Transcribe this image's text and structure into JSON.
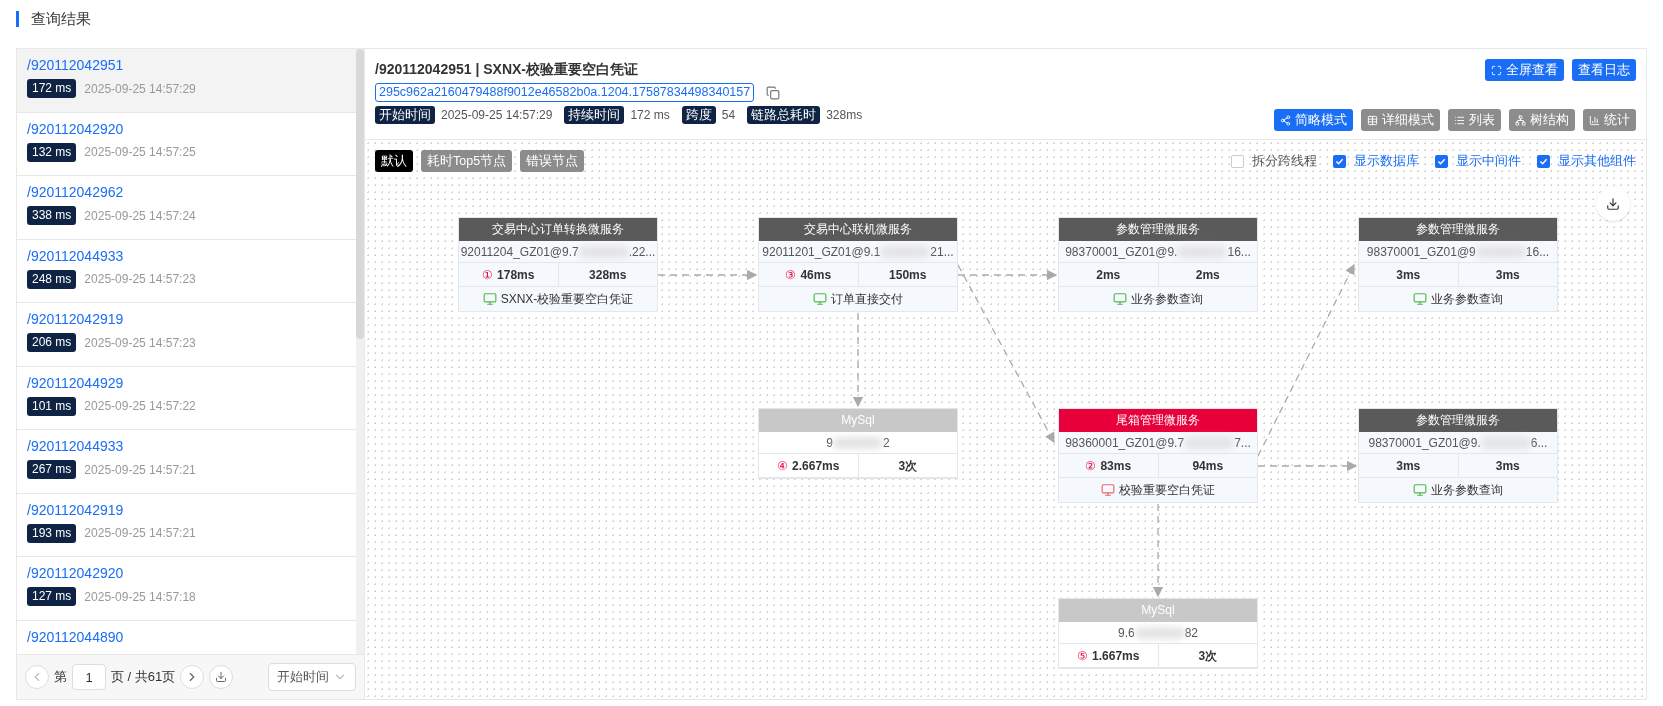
{
  "page_title": "查询结果",
  "results": [
    {
      "path": "/920112042951",
      "duration": "172 ms",
      "time": "2025-09-25 14:57:29",
      "selected": true
    },
    {
      "path": "/920112042920",
      "duration": "132 ms",
      "time": "2025-09-25 14:57:25",
      "selected": false
    },
    {
      "path": "/920112042962",
      "duration": "338 ms",
      "time": "2025-09-25 14:57:24",
      "selected": false
    },
    {
      "path": "/920112044933",
      "duration": "248 ms",
      "time": "2025-09-25 14:57:23",
      "selected": false
    },
    {
      "path": "/920112042919",
      "duration": "206 ms",
      "time": "2025-09-25 14:57:23",
      "selected": false
    },
    {
      "path": "/920112044929",
      "duration": "101 ms",
      "time": "2025-09-25 14:57:22",
      "selected": false
    },
    {
      "path": "/920112044933",
      "duration": "267 ms",
      "time": "2025-09-25 14:57:21",
      "selected": false
    },
    {
      "path": "/920112042919",
      "duration": "193 ms",
      "time": "2025-09-25 14:57:21",
      "selected": false
    },
    {
      "path": "/920112042920",
      "duration": "127 ms",
      "time": "2025-09-25 14:57:18",
      "selected": false
    },
    {
      "path": "/920112044890",
      "selected": false
    }
  ],
  "pagination": {
    "prefix": "第",
    "page": "1",
    "suffix": "页 / 共61页",
    "sort": "开始时间"
  },
  "detail": {
    "title": "/920112042951 | SXNX-校验重要空白凭证",
    "trace_id": "295c962a2160479488f9012e46582b0a.1204.17587834498340157",
    "meta": [
      {
        "label": "开始时间",
        "value": "2025-09-25 14:57:29"
      },
      {
        "label": "持续时间",
        "value": "172 ms"
      },
      {
        "label": "跨度",
        "value": "54"
      },
      {
        "label": "链路总耗时",
        "value": "328ms"
      }
    ],
    "actions": [
      "全屏查看",
      "查看日志"
    ],
    "modes": [
      {
        "label": "简略模式",
        "selected": true
      },
      {
        "label": "详细模式",
        "selected": false
      },
      {
        "label": "列表",
        "selected": false
      },
      {
        "label": "树结构",
        "selected": false
      },
      {
        "label": "统计",
        "selected": false
      }
    ],
    "filters": [
      {
        "label": "默认",
        "selected": true
      },
      {
        "label": "耗时Top5节点",
        "selected": false
      },
      {
        "label": "错误节点",
        "selected": false
      }
    ],
    "options": [
      {
        "label": "拆分跨线程",
        "checked": false
      },
      {
        "label": "显示数据库",
        "checked": true
      },
      {
        "label": "显示中间件",
        "checked": true
      },
      {
        "label": "显示其他组件",
        "checked": true
      }
    ]
  },
  "graph": {
    "nodes": [
      {
        "kind": "service",
        "name": "交易中心订单转换微服务",
        "host": [
          "92011204_GZ01@9.7",
          ".22..."
        ],
        "rank": "①",
        "self_time": "178ms",
        "total": "328ms",
        "operation": "SXNX-校验重要空白凭证",
        "error": false
      },
      {
        "kind": "service",
        "name": "交易中心联机微服务",
        "host": [
          "92011201_GZ01@9.1",
          "21..."
        ],
        "rank": "③",
        "self_time": "46ms",
        "total": "150ms",
        "operation": "订单直接交付",
        "error": false
      },
      {
        "kind": "service",
        "name": "参数管理微服务",
        "host": [
          "98370001_GZ01@9.",
          "16..."
        ],
        "self_time": "2ms",
        "total": "2ms",
        "operation": "业务参数查询",
        "error": false
      },
      {
        "kind": "service",
        "name": "参数管理微服务",
        "host": [
          "98370001_GZ01@9",
          "16..."
        ],
        "self_time": "3ms",
        "total": "3ms",
        "operation": "业务参数查询",
        "error": false
      },
      {
        "kind": "database",
        "name": "MySql",
        "host": [
          "9",
          "2"
        ],
        "rank": "④",
        "self_time": "2.667ms",
        "total": "3次"
      },
      {
        "kind": "service",
        "name": "尾箱管理微服务",
        "host": [
          "98360001_GZ01@9.7",
          "7..."
        ],
        "rank": "②",
        "self_time": "83ms",
        "total": "94ms",
        "operation": "校验重要空白凭证",
        "error": true
      },
      {
        "kind": "service",
        "name": "参数管理微服务",
        "host": [
          "98370001_GZ01@9.",
          "6..."
        ],
        "self_time": "3ms",
        "total": "3ms",
        "operation": "业务参数查询",
        "error": false
      },
      {
        "kind": "database",
        "name": "MySql",
        "host": [
          "9.6",
          "82"
        ],
        "rank": "⑤",
        "self_time": "1.667ms",
        "total": "3次"
      }
    ]
  }
}
